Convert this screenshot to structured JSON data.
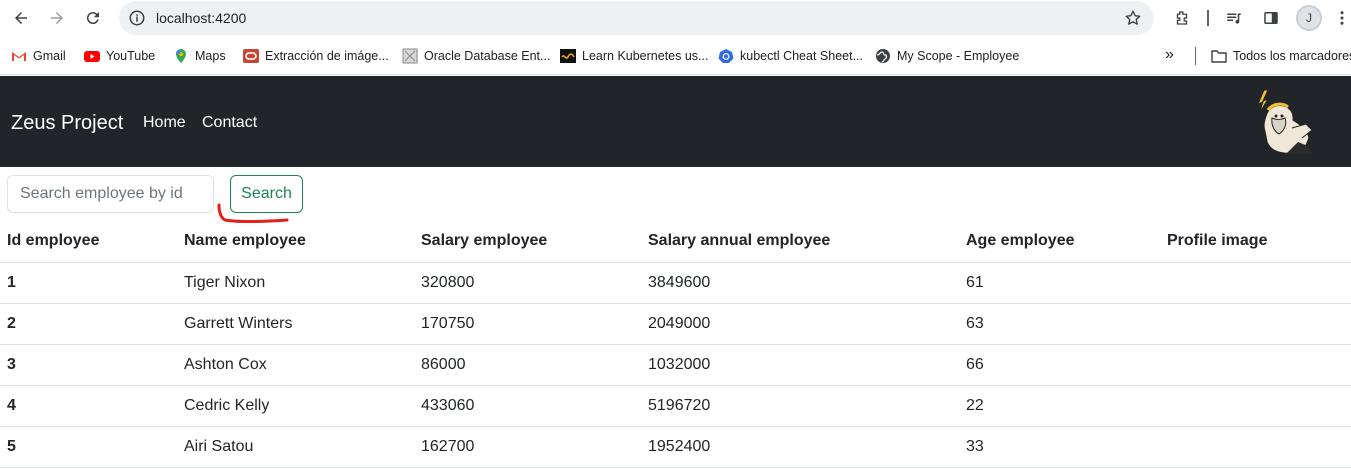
{
  "browser": {
    "url": "localhost:4200",
    "avatar_letter": "J",
    "bookmarks": [
      {
        "label": "Gmail",
        "icon": "gmail-icon"
      },
      {
        "label": "YouTube",
        "icon": "youtube-icon"
      },
      {
        "label": "Maps",
        "icon": "maps-icon"
      },
      {
        "label": "Extracción de imáge...",
        "icon": "oracle-icon"
      },
      {
        "label": "Oracle Database Ent...",
        "icon": "page-icon"
      },
      {
        "label": "Learn Kubernetes us...",
        "icon": "kubernetes-learn-icon"
      },
      {
        "label": "kubectl Cheat Sheet...",
        "icon": "kubernetes-icon"
      },
      {
        "label": "My Scope - Employee",
        "icon": "globe-icon"
      }
    ],
    "all_bookmarks_label": "Todos los marcadores"
  },
  "navbar": {
    "brand": "Zeus Project",
    "links": [
      "Home",
      "Contact"
    ]
  },
  "search": {
    "placeholder": "Search employee by id",
    "value": "",
    "button_label": "Search"
  },
  "table": {
    "headers": [
      "Id employee",
      "Name employee",
      "Salary employee",
      "Salary annual employee",
      "Age employee",
      "Profile image"
    ],
    "rows": [
      [
        "1",
        "Tiger Nixon",
        "320800",
        "3849600",
        "61",
        ""
      ],
      [
        "2",
        "Garrett Winters",
        "170750",
        "2049000",
        "63",
        ""
      ],
      [
        "3",
        "Ashton Cox",
        "86000",
        "1032000",
        "66",
        ""
      ],
      [
        "4",
        "Cedric Kelly",
        "433060",
        "5196720",
        "22",
        ""
      ],
      [
        "5",
        "Airi Satou",
        "162700",
        "1952400",
        "33",
        ""
      ]
    ]
  },
  "colors": {
    "navbar_bg": "#212529",
    "search_button": "#198754",
    "annotation_mark": "#e0201a"
  }
}
